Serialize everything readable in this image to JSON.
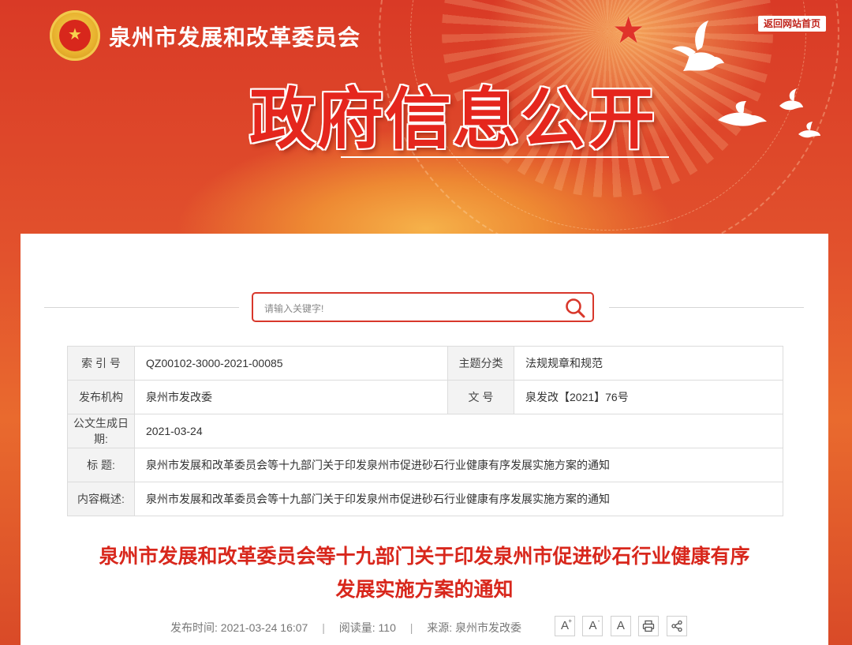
{
  "header": {
    "site_name": "泉州市发展和改革委员会",
    "home_link": "返回网站首页",
    "banner_title": "政府信息公开"
  },
  "search": {
    "placeholder": "请输入关键字!"
  },
  "meta": {
    "index_label": "索 引 号",
    "index_value": "QZ00102-3000-2021-00085",
    "topic_label": "主题分类",
    "topic_value": "法规规章和规范",
    "publisher_label": "发布机构",
    "publisher_value": "泉州市发改委",
    "docno_label": "文 号",
    "docno_value": "泉发改【2021】76号",
    "date_label": "公文生成日期:",
    "date_value": "2021-03-24",
    "title_label": "标 题:",
    "title_value": "泉州市发展和改革委员会等十九部门关于印发泉州市促进砂石行业健康有序发展实施方案的通知",
    "summary_label": "内容概述:",
    "summary_value": "泉州市发展和改革委员会等十九部门关于印发泉州市促进砂石行业健康有序发展实施方案的通知"
  },
  "article": {
    "title_line1": "泉州市发展和改革委员会等十九部门关于印发泉州市促进砂石行业健康有序",
    "title_line2": "发展实施方案的通知",
    "publish_time_label": "发布时间:",
    "publish_time": "2021-03-24 16:07",
    "views_label": "阅读量:",
    "views": "110",
    "source_label": "来源:",
    "source": "泉州市发改委"
  },
  "tools": {
    "font_large": "A",
    "font_large_mark": "+",
    "font_small": "A",
    "font_small_mark": "-",
    "font_default": "A"
  },
  "colors": {
    "brand_red": "#d8271c",
    "banner_red": "#e5261d",
    "table_label_bg": "#f3f3f3"
  },
  "icons": [
    "emblem-icon",
    "star-icon",
    "dove-icon",
    "search-icon",
    "print-icon",
    "share-icon"
  ]
}
